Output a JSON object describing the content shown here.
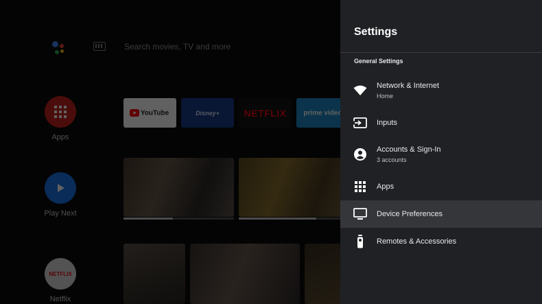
{
  "home": {
    "search": {
      "text": "Search movies, TV and more"
    },
    "sidebar": {
      "apps": {
        "label": "Apps"
      },
      "play_next": {
        "label": "Play Next"
      },
      "netflix": {
        "label": "Netflix",
        "logo": "NETFLIX"
      }
    },
    "app_tiles": {
      "youtube": "YouTube",
      "disney": "Disney+",
      "netflix": "NETFLIX",
      "prime": "prime video"
    },
    "play_next_progress": [
      0.45,
      0.75
    ]
  },
  "settings": {
    "title": "Settings",
    "section_header": "General Settings",
    "items": [
      {
        "id": "network",
        "label": "Network & Internet",
        "sublabel": "Home",
        "icon": "wifi-icon"
      },
      {
        "id": "inputs",
        "label": "Inputs",
        "sublabel": "",
        "icon": "input-icon"
      },
      {
        "id": "accounts",
        "label": "Accounts & Sign-In",
        "sublabel": "3 accounts",
        "icon": "account-icon"
      },
      {
        "id": "apps",
        "label": "Apps",
        "sublabel": "",
        "icon": "apps-grid-icon"
      },
      {
        "id": "device",
        "label": "Device Preferences",
        "sublabel": "",
        "icon": "tv-icon",
        "focused": true
      },
      {
        "id": "remotes",
        "label": "Remotes & Accessories",
        "sublabel": "",
        "icon": "remote-icon"
      }
    ]
  },
  "colors": {
    "panel_bg": "#202124",
    "focused_bg": "#35363a",
    "apps_red": "#c5221f",
    "play_blue": "#1a73e8",
    "netflix_red": "#e50914"
  }
}
